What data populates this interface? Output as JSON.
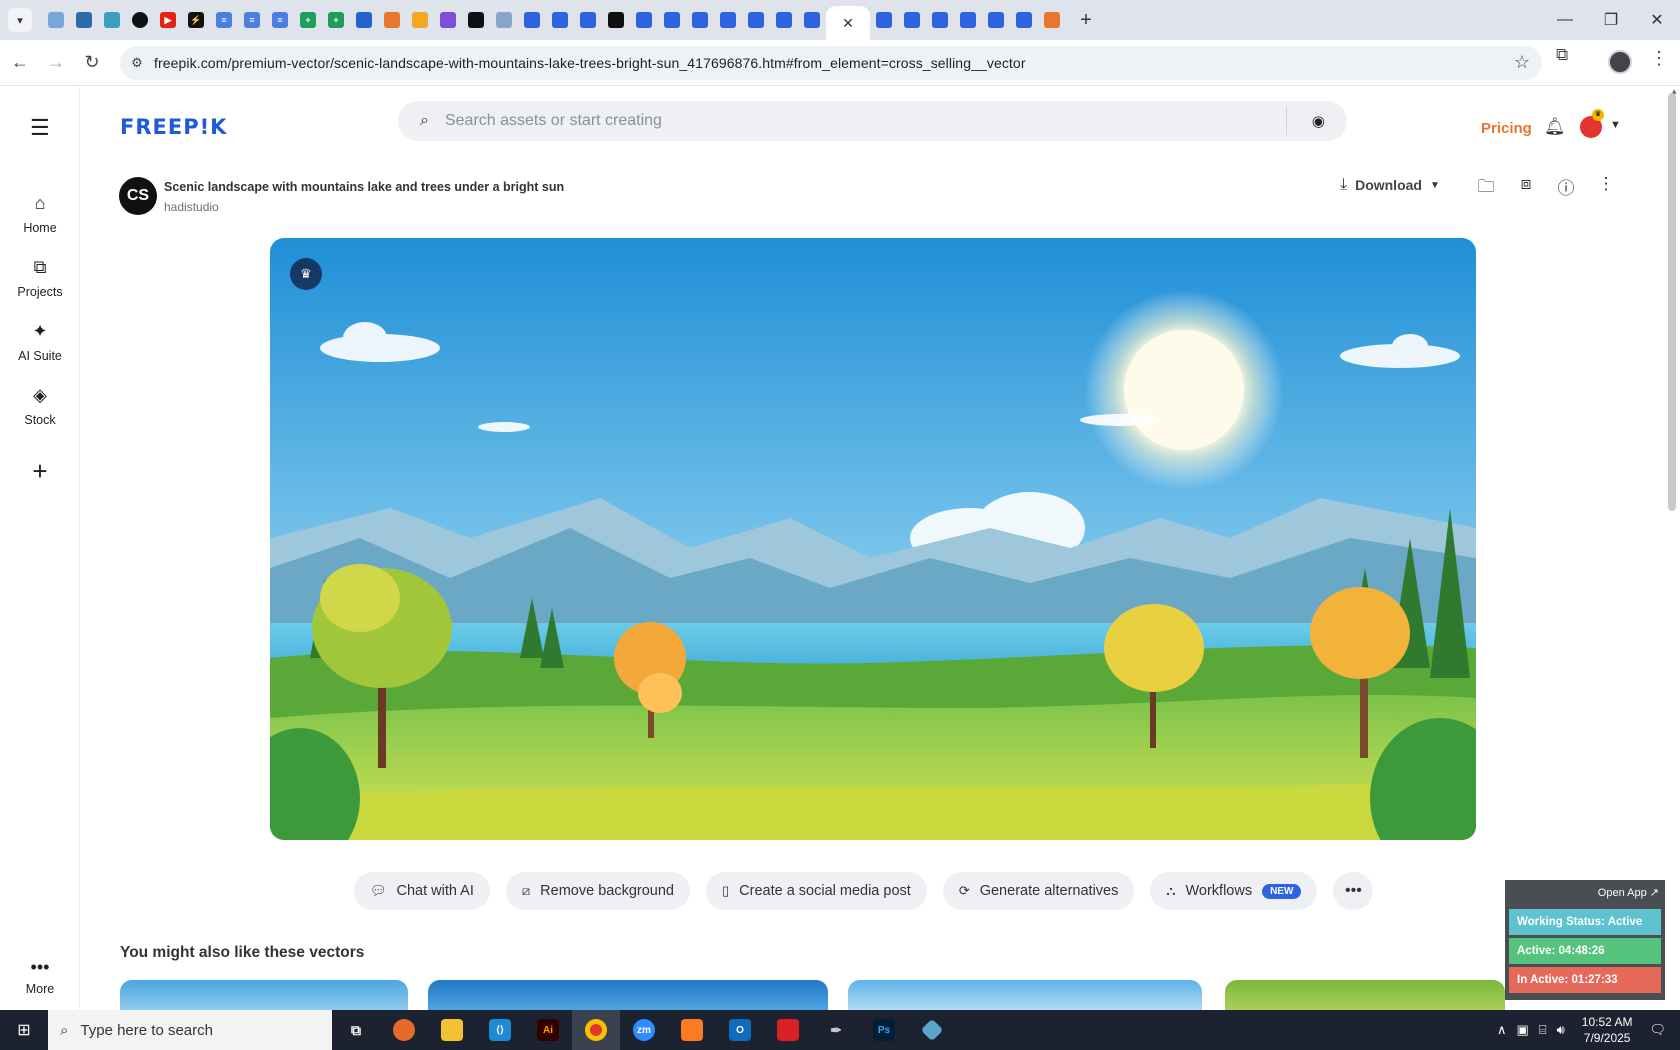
{
  "browser": {
    "new_tab_label": "+",
    "url": "freepik.com/premium-vector/scenic-landscape-with-mountains-lake-trees-bright-sun_417696876.htm#from_element=cross_selling__vector"
  },
  "sidebar": {
    "items": [
      {
        "label": "Home",
        "icon": "home-icon"
      },
      {
        "label": "Projects",
        "icon": "projects-icon"
      },
      {
        "label": "AI Suite",
        "icon": "sparkle-icon"
      },
      {
        "label": "Stock",
        "icon": "stock-icon"
      }
    ],
    "more_label": "More"
  },
  "header": {
    "logo": "FREEP!K",
    "search_placeholder": "Search assets or start creating",
    "pricing_label": "Pricing"
  },
  "asset": {
    "author_initials": "CS",
    "title": "Scenic landscape with mountains lake and trees under a bright sun",
    "author": "hadistudio",
    "download_label": "Download"
  },
  "actions": [
    {
      "label": "Chat with AI",
      "icon": "chat-icon"
    },
    {
      "label": "Remove background",
      "icon": "remove-bg-icon"
    },
    {
      "label": "Create a social media post",
      "icon": "phone-icon"
    },
    {
      "label": "Generate alternatives",
      "icon": "refresh-icon"
    },
    {
      "label": "Workflows",
      "icon": "workflow-icon",
      "badge": "NEW"
    }
  ],
  "related": {
    "title": "You might also like these vectors"
  },
  "tracker": {
    "open_app": "Open App ↗",
    "working_status": "Working Status: Active",
    "active": "Active: 04:48:26",
    "inactive": "In Active: 01:27:33"
  },
  "taskbar": {
    "search_placeholder": "Type here to search",
    "time": "10:52 AM",
    "date": "7/9/2025"
  },
  "colors": {
    "brand": "#1f5bd8",
    "pricing": "#e8762c",
    "new_badge": "#2e62e0"
  }
}
